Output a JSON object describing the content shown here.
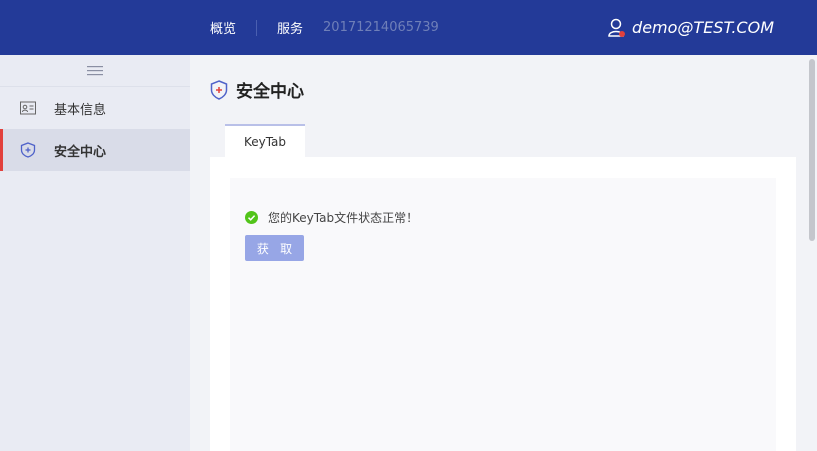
{
  "topbar": {
    "nav": [
      {
        "label": "概览"
      },
      {
        "label": "服务"
      }
    ],
    "service_id": "20171214065739",
    "user": "demo@TEST.COM"
  },
  "sidebar": {
    "items": [
      {
        "label": "基本信息",
        "icon": "id-card-icon",
        "active": false
      },
      {
        "label": "安全中心",
        "icon": "shield-icon",
        "active": true
      }
    ]
  },
  "page": {
    "title": "安全中心",
    "tabs": [
      {
        "label": "KeyTab"
      }
    ],
    "status_text": "您的KeyTab文件状态正常！",
    "fetch_button": "获 取"
  },
  "colors": {
    "header": "#233a98",
    "accent_bar": "#e2403c",
    "button": "#97a6e6",
    "success": "#52c41a"
  }
}
